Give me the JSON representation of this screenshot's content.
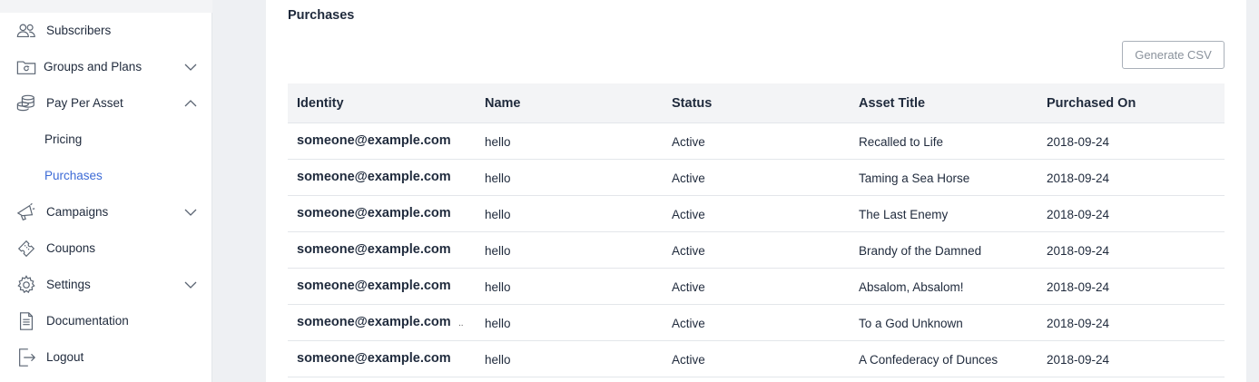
{
  "sidebar": {
    "items": [
      {
        "label": "Subscribers",
        "icon": "users-icon"
      },
      {
        "label": "Groups and Plans",
        "icon": "folder-icon",
        "expand": "chevron-down-icon"
      },
      {
        "label": "Pay Per Asset",
        "icon": "coins-icon",
        "expand": "chevron-up-icon",
        "children": [
          {
            "label": "Pricing"
          },
          {
            "label": "Purchases",
            "active": true
          }
        ]
      },
      {
        "label": "Campaigns",
        "icon": "megaphone-icon",
        "expand": "chevron-down-icon"
      },
      {
        "label": "Coupons",
        "icon": "ticket-icon"
      },
      {
        "label": "Settings",
        "icon": "gear-icon",
        "expand": "chevron-down-icon"
      },
      {
        "label": "Documentation",
        "icon": "document-icon"
      },
      {
        "label": "Logout",
        "icon": "logout-icon"
      }
    ]
  },
  "main": {
    "title": "Purchases",
    "generate_csv_label": "Generate CSV",
    "table": {
      "headers": [
        "Identity",
        "Name",
        "Status",
        "Asset Title",
        "Purchased On"
      ],
      "rows": [
        {
          "identity": "someone@example.com",
          "name": "hello",
          "status": "Active",
          "asset": "Recalled to Life",
          "date": "2018-09-24"
        },
        {
          "identity": "someone@example.com",
          "name": "hello",
          "status": "Active",
          "asset": "Taming a Sea Horse",
          "date": "2018-09-24"
        },
        {
          "identity": "someone@example.com",
          "name": "hello",
          "status": "Active",
          "asset": "The Last Enemy",
          "date": "2018-09-24"
        },
        {
          "identity": "someone@example.com",
          "name": "hello",
          "status": "Active",
          "asset": "Brandy of the Damned",
          "date": "2018-09-24"
        },
        {
          "identity": "someone@example.com",
          "name": "hello",
          "status": "Active",
          "asset": "Absalom, Absalom!",
          "date": "2018-09-24"
        },
        {
          "identity": "someone@example.com",
          "name": "hello",
          "status": "Active",
          "asset": "To a God Unknown",
          "date": "2018-09-24"
        },
        {
          "identity": "someone@example.com",
          "name": "hello",
          "status": "Active",
          "asset": "A Confederacy of Dunces",
          "date": "2018-09-24"
        }
      ],
      "truncation_mark": ".."
    }
  },
  "colors": {
    "accent": "#3d6bd6",
    "text": "#1f2a3c",
    "background": "#eef0f3",
    "header_bg": "#f3f4f6"
  }
}
